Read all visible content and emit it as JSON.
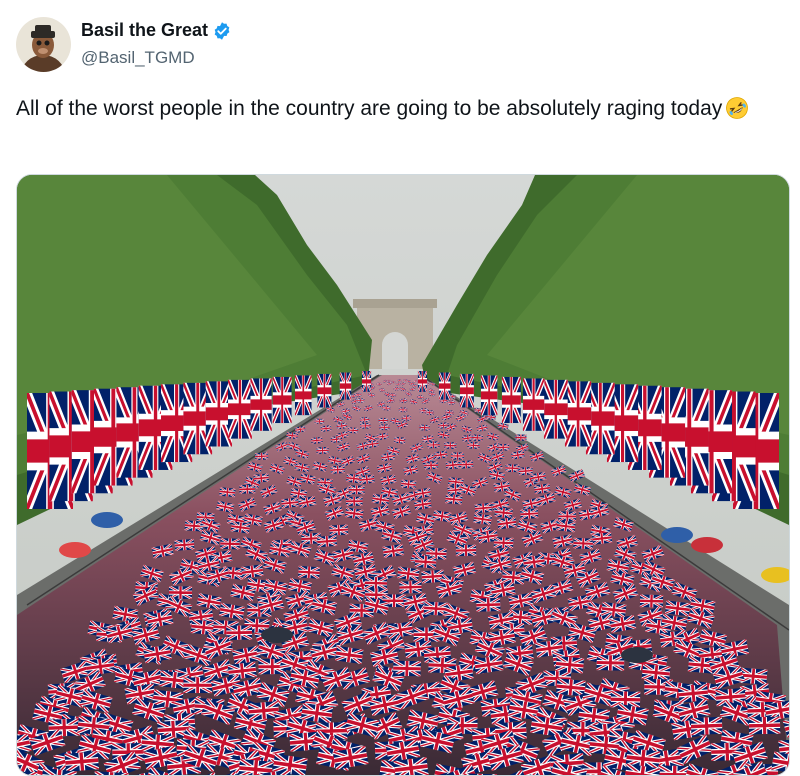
{
  "author": {
    "display_name": "Basil the Great",
    "handle": "@Basil_TGMD",
    "verified": true,
    "avatar_icon": "avatar-image",
    "verified_icon": "verified-badge-icon"
  },
  "tweet": {
    "text": "All of the worst people in the country are going to be absolutely raging today",
    "emoji_icon": "rolling-on-the-floor-laughing-emoji"
  },
  "colors": {
    "verified_blue": "#1d9bf0",
    "name_text": "#0f1419",
    "handle_text": "#536471",
    "flag_blue": "#012169",
    "flag_red": "#c8102e"
  }
}
